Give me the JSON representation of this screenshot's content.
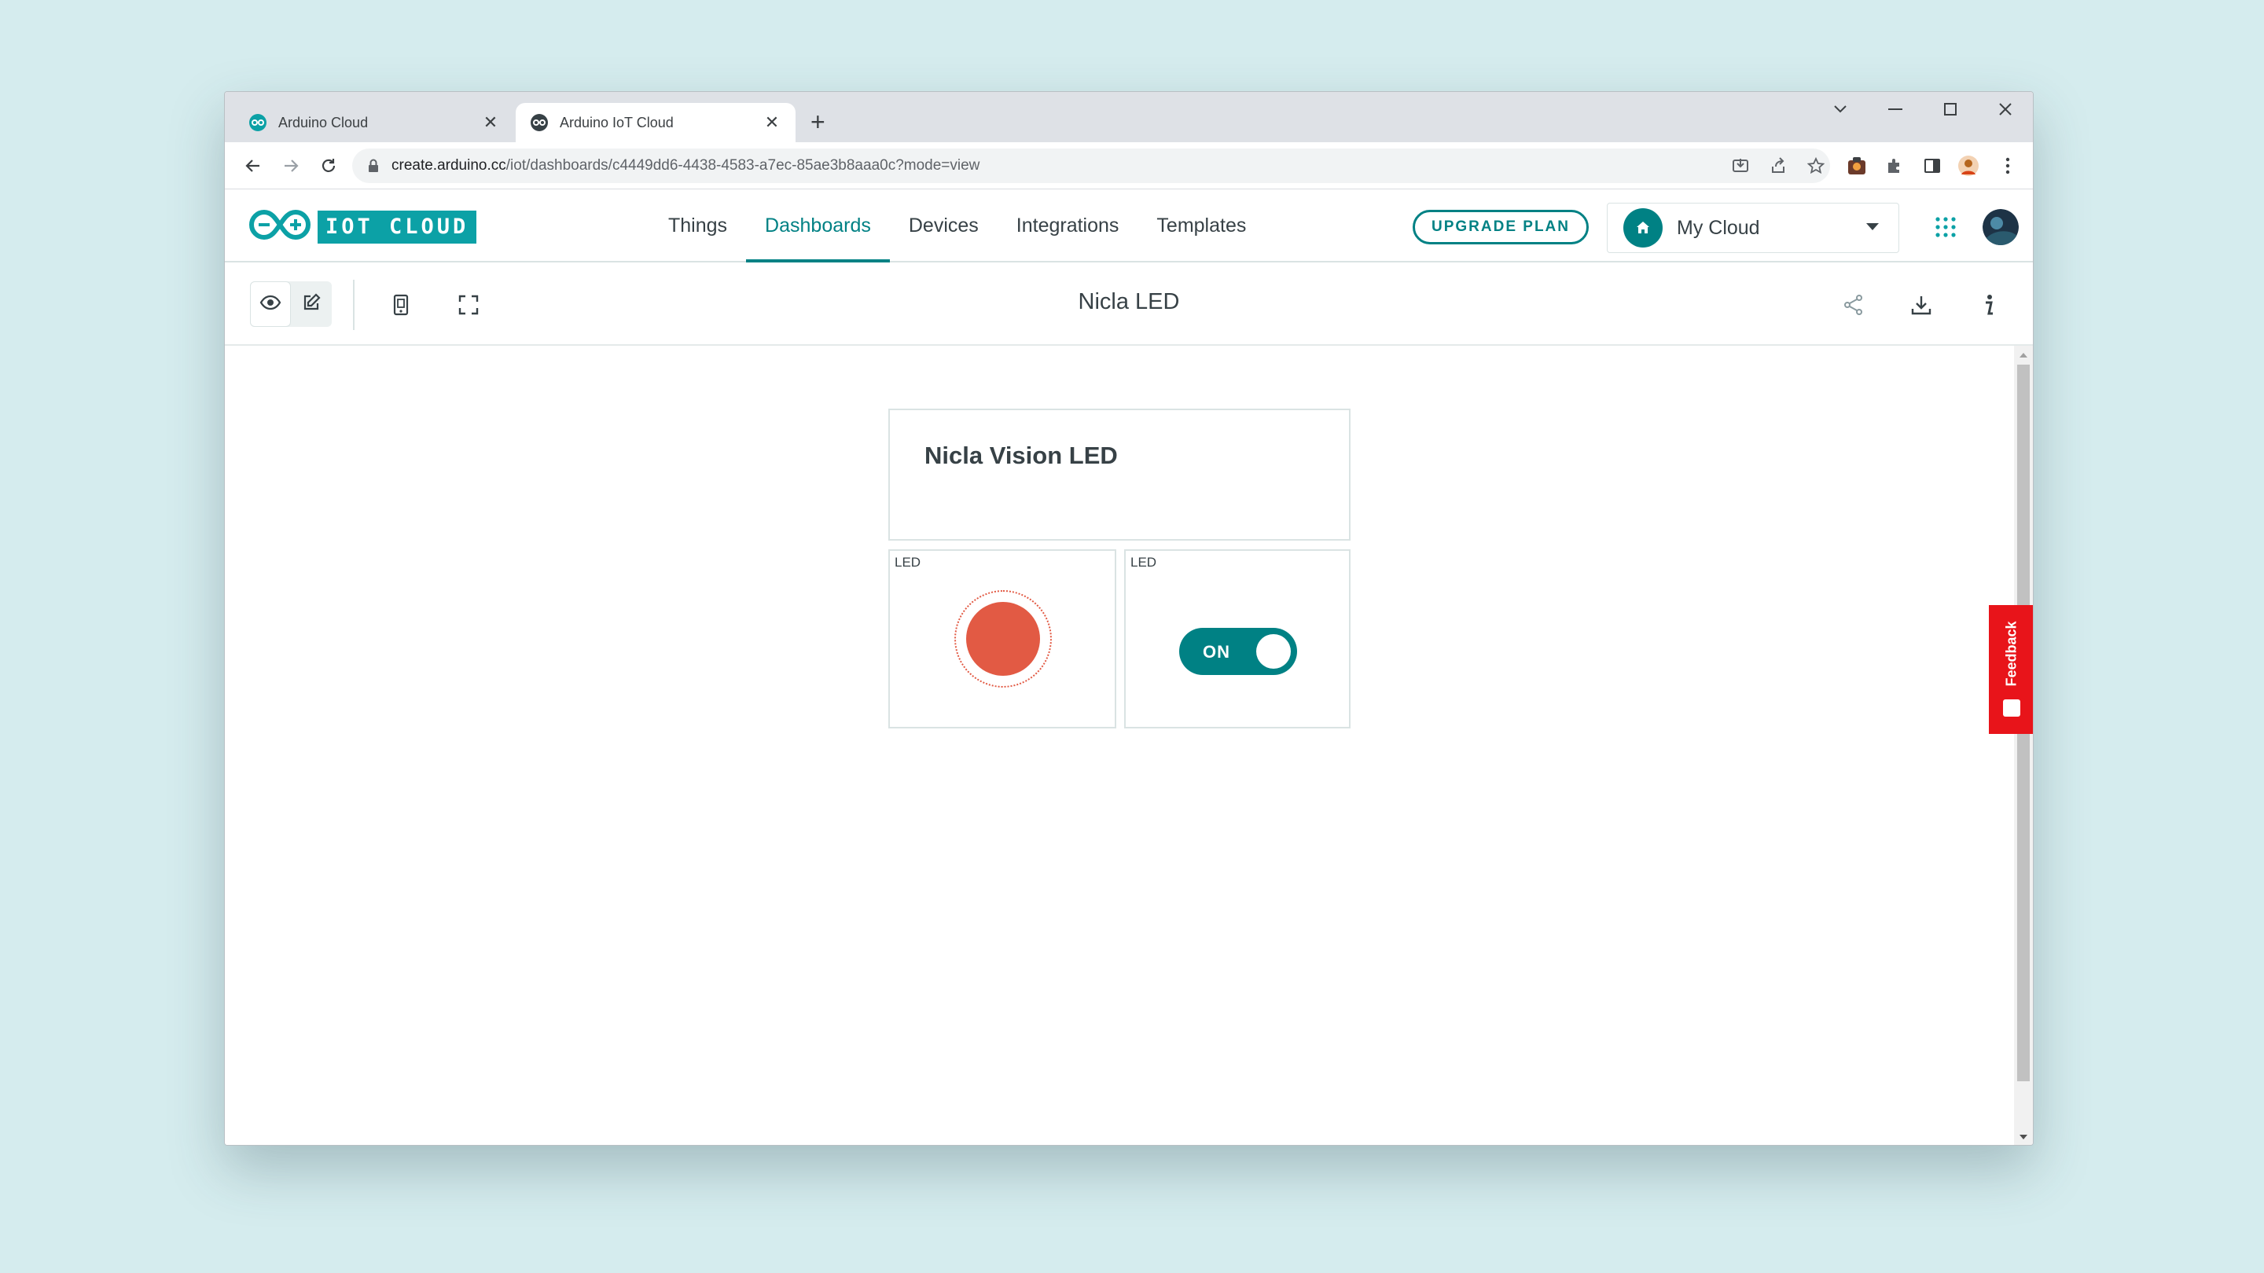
{
  "browser": {
    "tabs": [
      {
        "title": "Arduino Cloud",
        "active": false
      },
      {
        "title": "Arduino IoT Cloud",
        "active": true
      }
    ],
    "url_host": "create.arduino.cc",
    "url_path": "/iot/dashboards/c4449dd6-4438-4583-a7ec-85ae3b8aaa0c?mode=view"
  },
  "app": {
    "logo_text": "IOT CLOUD",
    "nav": [
      {
        "label": "Things",
        "active": false
      },
      {
        "label": "Dashboards",
        "active": true
      },
      {
        "label": "Devices",
        "active": false
      },
      {
        "label": "Integrations",
        "active": false
      },
      {
        "label": "Templates",
        "active": false
      }
    ],
    "upgrade_label": "UPGRADE PLAN",
    "space_label": "My Cloud"
  },
  "dashboard": {
    "title": "Nicla LED",
    "mode": "view",
    "widgets": {
      "title_widget": "Nicla Vision LED",
      "led_label": "LED",
      "led_state": "on",
      "switch_label": "LED",
      "switch_text": "ON"
    }
  },
  "feedback_label": "Feedback",
  "colors": {
    "accent": "#008184",
    "brand_teal": "#0ca1a6",
    "led_on": "#e25a44",
    "feedback": "#e8141a",
    "background": "#d5ecee"
  }
}
